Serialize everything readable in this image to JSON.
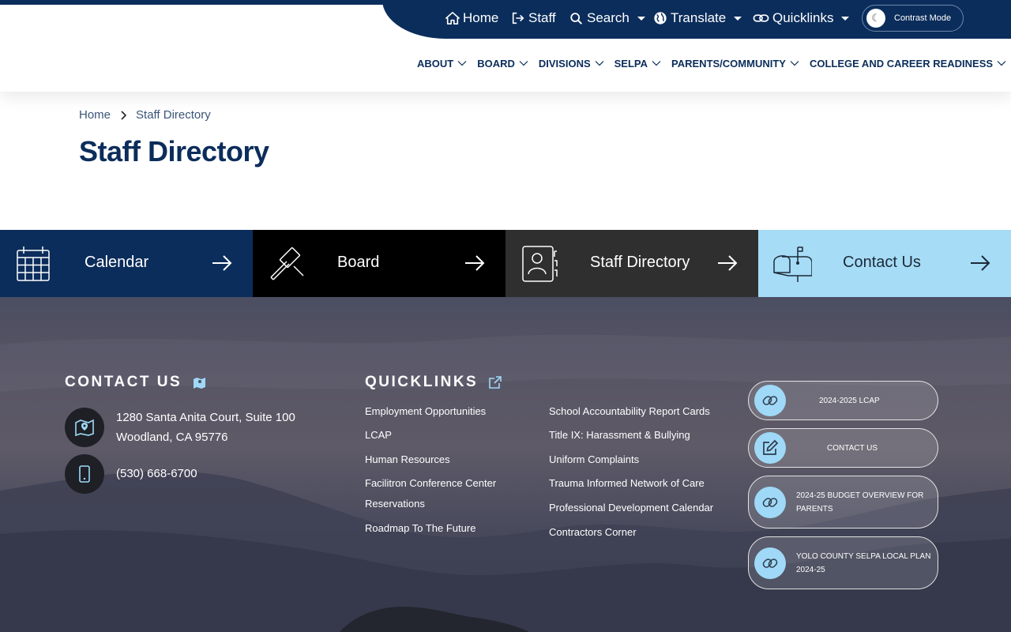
{
  "utility_nav": {
    "home": "Home",
    "staff": "Staff",
    "search": "Search",
    "translate": "Translate",
    "quicklinks": "Quicklinks",
    "contrast_mode": "Contrast Mode"
  },
  "main_nav": [
    {
      "label": "ABOUT"
    },
    {
      "label": "BOARD"
    },
    {
      "label": "DIVISIONS"
    },
    {
      "label": "SELPA"
    },
    {
      "label": "PARENTS/COMMUNITY"
    },
    {
      "label": "COLLEGE AND CAREER READINESS"
    }
  ],
  "breadcrumb": {
    "home": "Home",
    "current": "Staff Directory"
  },
  "page_title": "Staff Directory",
  "tiles": [
    {
      "label": "Calendar",
      "icon": "calendar-icon",
      "bg": "#0b2d5b",
      "color": "#ffffff"
    },
    {
      "label": "Board",
      "icon": "gavel-icon",
      "bg": "#000000",
      "color": "#ffffff"
    },
    {
      "label": "Staff Directory",
      "icon": "contact-book-icon",
      "bg": "#2f2f2f",
      "color": "#ffffff"
    },
    {
      "label": "Contact Us",
      "icon": "mailbox-icon",
      "bg": "#a6dcf6",
      "color": "#1c2a38"
    }
  ],
  "footer": {
    "contact_heading": "CONTACT US",
    "address_line1": "1280 Santa Anita Court, Suite 100",
    "address_line2": "Woodland, CA 95776",
    "phone": "(530) 668-6700",
    "quicklinks_heading": "QUICKLINKS",
    "quicklinks_col1": [
      "Employment Opportunities",
      "LCAP",
      "Human Resources",
      "Facilitron Conference Center",
      "Reservations",
      "Roadmap To The Future"
    ],
    "quicklinks_col2": [
      "School Accountability Report Cards",
      "Title IX: Harassment & Bullying",
      "Uniform Complaints",
      "Trauma Informed Network of Care",
      "Professional Development Calendar",
      "Contractors Corner"
    ],
    "buttons": [
      {
        "line1": "2024-2025 LCAP",
        "line2": "",
        "icon": "link-icon"
      },
      {
        "line1": "CONTACT US",
        "line2": "",
        "icon": "edit-icon"
      },
      {
        "line1": "2024-25 BUDGET OVERVIEW FOR",
        "line2": "PARENTS",
        "icon": "link-icon"
      },
      {
        "line1": "YOLO COUNTY SELPA LOCAL PLAN",
        "line2": "2024-25",
        "icon": "link-icon"
      }
    ]
  },
  "colors": {
    "navy": "#0b2d5b",
    "light_blue": "#a6dcf6",
    "accent_icon": "#9fd9f7"
  }
}
